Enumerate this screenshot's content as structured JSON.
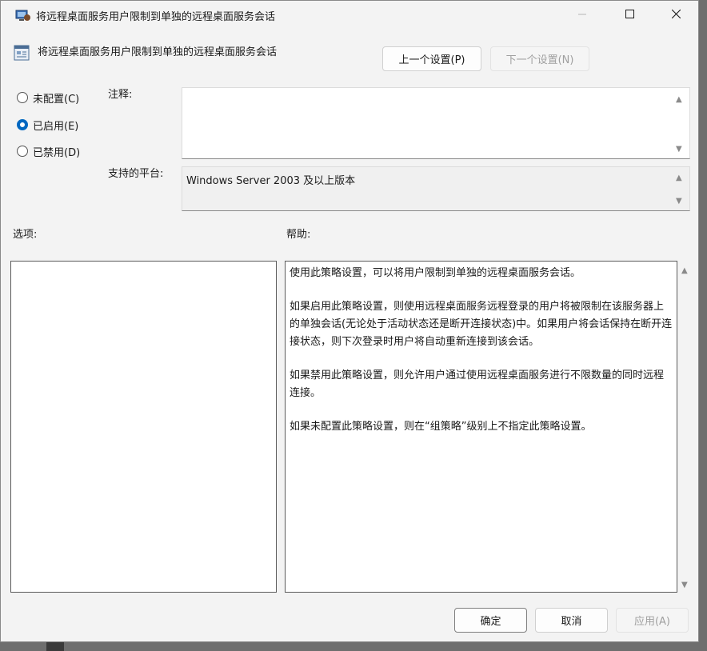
{
  "window": {
    "title": "将远程桌面服务用户限制到单独的远程桌面服务会话",
    "minimize_icon": "minimize-icon",
    "maximize_icon": "maximize-icon",
    "close_icon": "close-icon"
  },
  "header": {
    "policy_name": "将远程桌面服务用户限制到单独的远程桌面服务会话",
    "prev_label": "上一个设置(P)",
    "next_label": "下一个设置(N)"
  },
  "state": {
    "options": [
      {
        "label": "未配置(C)",
        "checked": false
      },
      {
        "label": "已启用(E)",
        "checked": true
      },
      {
        "label": "已禁用(D)",
        "checked": false
      }
    ]
  },
  "labels": {
    "comment": "注释:",
    "platform": "支持的平台:",
    "options": "选项:",
    "help": "帮助:"
  },
  "comment_value": "",
  "platform_value": "Windows Server 2003 及以上版本",
  "help": {
    "paragraphs": [
      "使用此策略设置，可以将用户限制到单独的远程桌面服务会话。",
      "如果启用此策略设置，则使用远程桌面服务远程登录的用户将被限制在该服务器上的单独会话(无论处于活动状态还是断开连接状态)中。如果用户将会话保持在断开连接状态，则下次登录时用户将自动重新连接到该会话。",
      "如果禁用此策略设置，则允许用户通过使用远程桌面服务进行不限数量的同时远程连接。",
      "如果未配置此策略设置，则在“组策略”级别上不指定此策略设置。"
    ]
  },
  "footer": {
    "ok_label": "确定",
    "cancel_label": "取消",
    "apply_label": "应用(A)"
  },
  "colors": {
    "accent": "#0067c0",
    "window_bg": "#f3f3f3"
  }
}
